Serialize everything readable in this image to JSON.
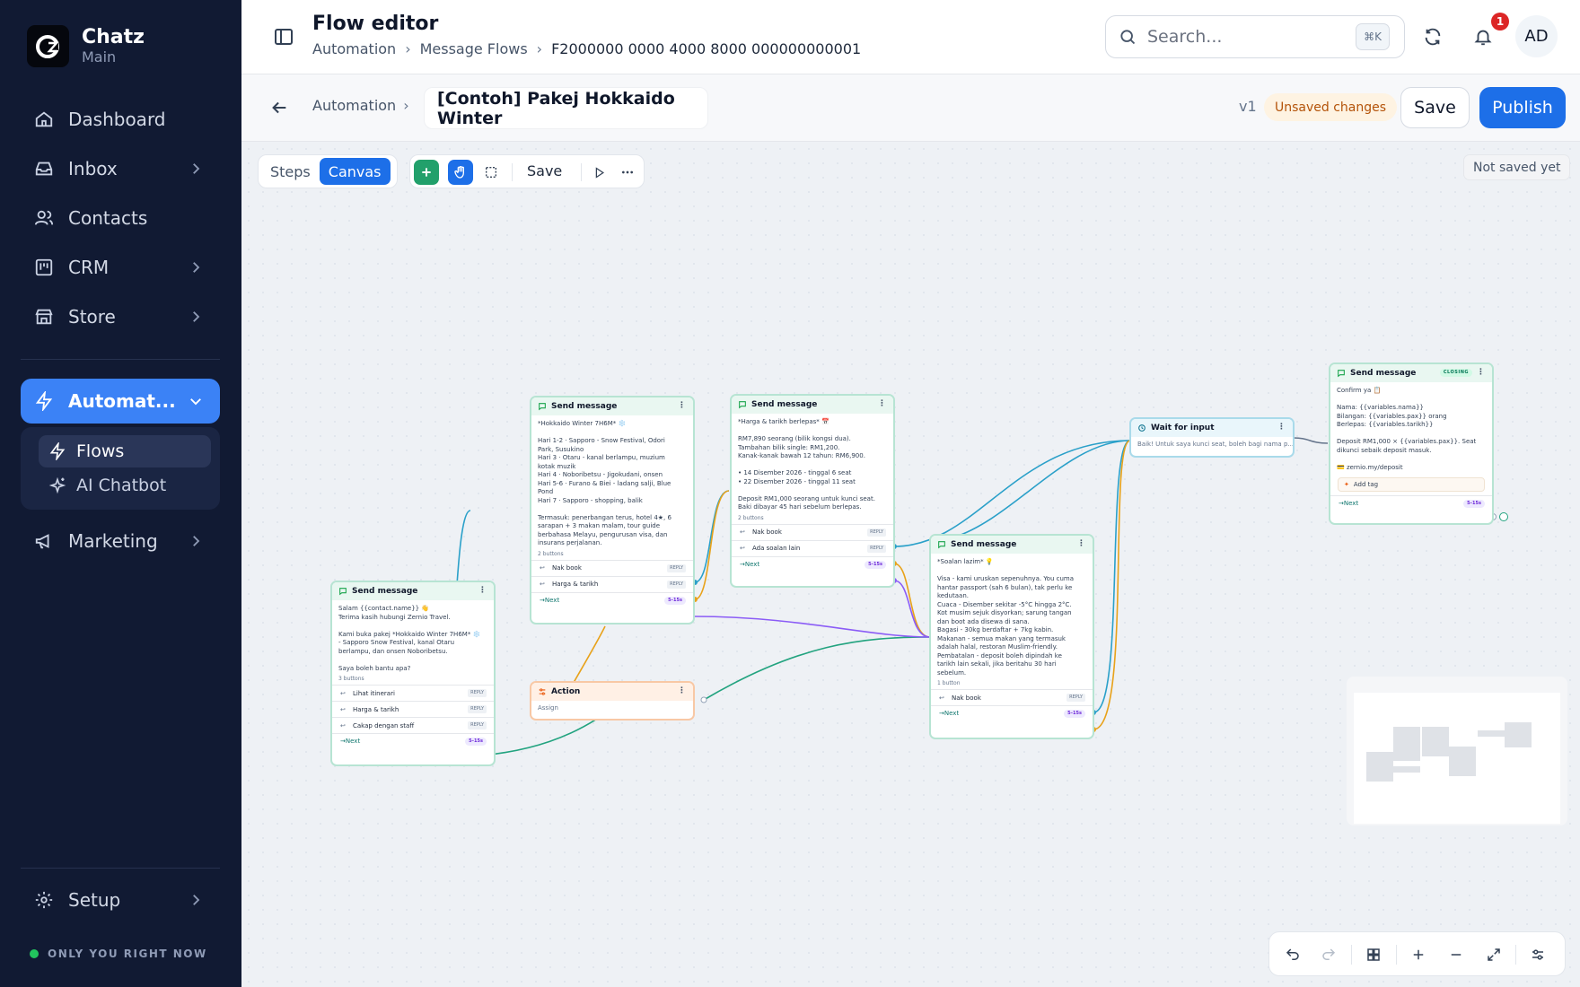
{
  "brand": {
    "name": "Chatz",
    "workspace": "Main"
  },
  "nav": {
    "items": [
      {
        "label": "Dashboard"
      },
      {
        "label": "Inbox"
      },
      {
        "label": "Contacts"
      },
      {
        "label": "CRM"
      },
      {
        "label": "Store"
      },
      {
        "label": "Automat..."
      },
      {
        "label": "Marketing"
      },
      {
        "label": "Setup"
      }
    ],
    "sub_items": [
      {
        "label": "Flows"
      },
      {
        "label": "AI Chatbot"
      }
    ],
    "status": "ONLY YOU RIGHT NOW"
  },
  "header": {
    "title": "Flow editor",
    "breadcrumbs": [
      "Automation",
      "Message Flows",
      "F2000000 0000 4000 8000 000000000001"
    ],
    "search_placeholder": "Search...",
    "search_shortcut": "⌘K",
    "notification_count": "1",
    "avatar_initials": "AD"
  },
  "editor": {
    "crumb": "Automation",
    "flow_name": "[Contoh] Pakej Hokkaido Winter",
    "version": "v1",
    "unsaved_badge": "Unsaved changes",
    "save_label": "Save",
    "publish_label": "Publish"
  },
  "canvas": {
    "mode_steps": "Steps",
    "mode_canvas": "Canvas",
    "toolbar_save": "Save",
    "save_status": "Not saved yet"
  },
  "nodes": {
    "n1": {
      "title": "Send message",
      "body": "Salam {{contact.name}} 👋\nTerima kasih hubungi Zernio Travel.\n\nKami buka pakej *Hokkaido Winter 7H6M* ❄️\n- Sapporo Snow Festival, kanal Otaru\nberlampu, dan onsen Noboribetsu.\n\nSaya boleh bantu apa?",
      "count": "3 buttons",
      "buttons": [
        {
          "label": "Lihat itinerari",
          "tag": "REPLY"
        },
        {
          "label": "Harga & tarikh",
          "tag": "REPLY"
        },
        {
          "label": "Cakap dengan staff",
          "tag": "REPLY"
        }
      ],
      "next": "Next",
      "delay": "5–15s"
    },
    "n2": {
      "title": "Send message",
      "body": "*Hokkaido Winter 7H6M* ❄️\n\nHari 1-2 · Sapporo - Snow Festival, Odori\nPark, Susukino\nHari 3 · Otaru - kanal berlampu, muzium\nkotak muzik\nHari 4 · Noboribetsu - Jigokudani, onsen\nHari 5-6 · Furano & Biei - ladang salji, Blue\nPond\nHari 7 · Sapporo - shopping, balik\n\nTermasuk: penerbangan terus, hotel 4★, 6\nsarapan + 3 makan malam, tour guide\nberbahasa Melayu, pengurusan visa, dan\ninsurans perjalanan.",
      "count": "2 buttons",
      "buttons": [
        {
          "label": "Nak book",
          "tag": "REPLY"
        },
        {
          "label": "Harga & tarikh",
          "tag": "REPLY"
        }
      ],
      "next": "Next",
      "delay": "5–15s"
    },
    "n3": {
      "title": "Send message",
      "body": "*Harga & tarikh berlepas* 📅\n\nRM7,890 seorang (bilik kongsi dua).\nTambahan bilik single: RM1,200.\nKanak-kanak bawah 12 tahun: RM6,900.\n\n• 14 Disember 2026 - tinggal 6 seat\n• 22 Disember 2026 - tinggal 11 seat\n\nDeposit RM1,000 seorang untuk kunci seat.\nBaki dibayar 45 hari sebelum berlepas.",
      "count": "2 buttons",
      "buttons": [
        {
          "label": "Nak book",
          "tag": "REPLY"
        },
        {
          "label": "Ada soalan lain",
          "tag": "REPLY"
        }
      ],
      "next": "Next",
      "delay": "5–15s"
    },
    "action": {
      "title": "Action",
      "body": "Assign"
    },
    "n4": {
      "title": "Send message",
      "body": "*Soalan lazim* 💡\n\nVisa - kami uruskan sepenuhnya. You cuma\nhantar passport (sah 6 bulan), tak perlu ke\nkedutaan.\nCuaca - Disember sekitar -5°C hingga 2°C.\nKot musim sejuk disyorkan; sarung tangan\ndan boot ada disewa di sana.\nBagasi - 30kg berdaftar + 7kg kabin.\nMakanan - semua makan yang termasuk\nadalah halal, restoran Muslim-friendly.\nPembatalan - deposit boleh dipindah ke\ntarikh lain sekali, jika beritahu 30 hari\nsebelum.",
      "count": "1 button",
      "buttons": [
        {
          "label": "Nak book",
          "tag": "REPLY"
        }
      ],
      "next": "Next",
      "delay": "5–15s"
    },
    "wait": {
      "title": "Wait for input",
      "body": "Baik! Untuk saya kunci seat, boleh bagi nama p..."
    },
    "n5": {
      "title": "Send message",
      "tag": "CLOSING",
      "body": "Confirm ya 📋\n\nNama: {{variables.nama}}\nBilangan: {{variables.pax}} orang\nBerlepas: {{variables.tarikh}}\n\nDeposit RM1,000 × {{variables.pax}}. Seat\ndikunci sebaik deposit masuk.\n\n💳 zernio.my/deposit",
      "add_tag": "Add tag",
      "next": "Next",
      "delay": "5–15s"
    }
  },
  "colors": {
    "sidebar": "#111a33",
    "accent": "#1d6fe8",
    "edge_teal": "#22a37f",
    "edge_blue": "#2aa0c9",
    "edge_orange": "#e8a21a",
    "edge_purple": "#8b5cf6",
    "unsaved": "#b45309"
  }
}
